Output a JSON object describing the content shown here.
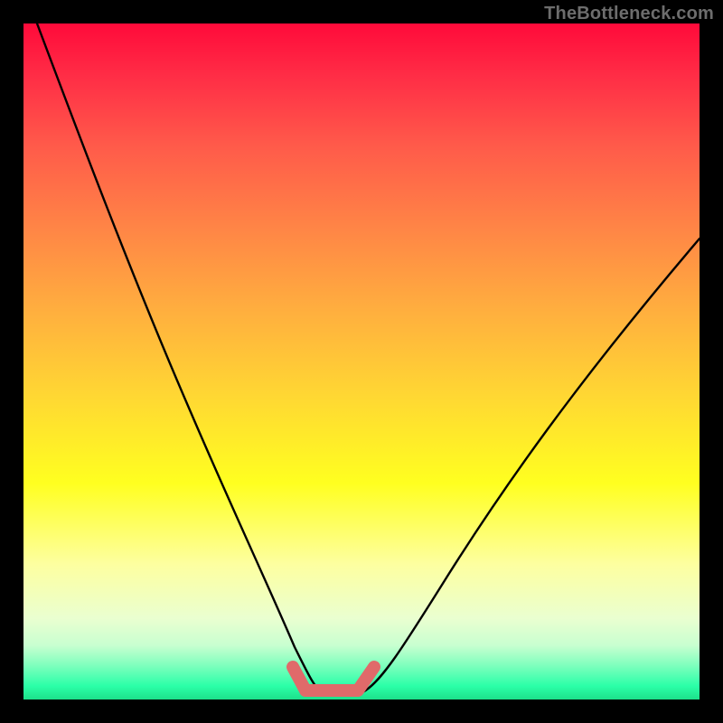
{
  "watermark": {
    "text": "TheBottleneck.com"
  },
  "chart_data": {
    "type": "line",
    "title": "",
    "xlabel": "",
    "ylabel": "",
    "xlim": [
      0,
      100
    ],
    "ylim": [
      0,
      100
    ],
    "grid": false,
    "legend": false,
    "series": [
      {
        "name": "bottleneck-curve",
        "color": "#000000",
        "x": [
          2,
          5,
          10,
          15,
          20,
          25,
          30,
          35,
          38,
          40,
          42,
          44,
          46,
          48,
          50,
          52,
          55,
          60,
          65,
          70,
          75,
          80,
          85,
          90,
          95,
          100
        ],
        "y": [
          100,
          92,
          80,
          68,
          56,
          45,
          34,
          22,
          14,
          8,
          3,
          1,
          0.5,
          0.5,
          0.5,
          1,
          3,
          9,
          17,
          25,
          32,
          39,
          46,
          53,
          59,
          65
        ]
      },
      {
        "name": "optimal-band",
        "color": "#e16a6a",
        "x": [
          40,
          42,
          44,
          46,
          48,
          50,
          52
        ],
        "y": [
          3,
          1,
          0.7,
          0.5,
          0.7,
          1,
          3
        ]
      }
    ],
    "background_gradient": {
      "direction": "top-to-bottom",
      "stops": [
        {
          "pos": 0,
          "color": "#ff0a3a"
        },
        {
          "pos": 50,
          "color": "#ffcf30"
        },
        {
          "pos": 70,
          "color": "#ffff20"
        },
        {
          "pos": 100,
          "color": "#1de08a"
        }
      ]
    }
  }
}
